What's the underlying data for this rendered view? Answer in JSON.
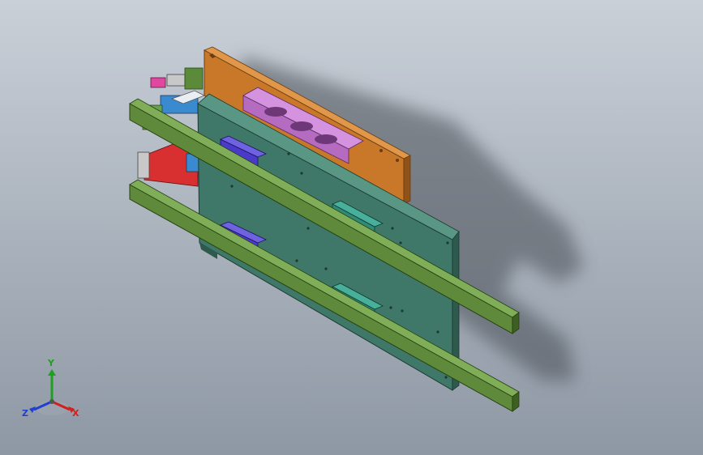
{
  "viewport": {
    "background_top": "#c9d0d8",
    "background_bottom": "#8e98a4"
  },
  "model": {
    "colors": {
      "back_plate": "#c9782a",
      "main_plate": "#3f7868",
      "rail": "#5f8a3c",
      "pink_block": "#c77ed0",
      "carriage_blue": "#4a3ac8",
      "carriage_teal": "#2f8a78",
      "red_bracket": "#d83030",
      "blue_part": "#3a8ad0"
    }
  },
  "triad": {
    "x_label": "X",
    "y_label": "Y",
    "z_label": "Z",
    "x_color": "#d02020",
    "y_color": "#20a020",
    "z_color": "#2040d0"
  }
}
